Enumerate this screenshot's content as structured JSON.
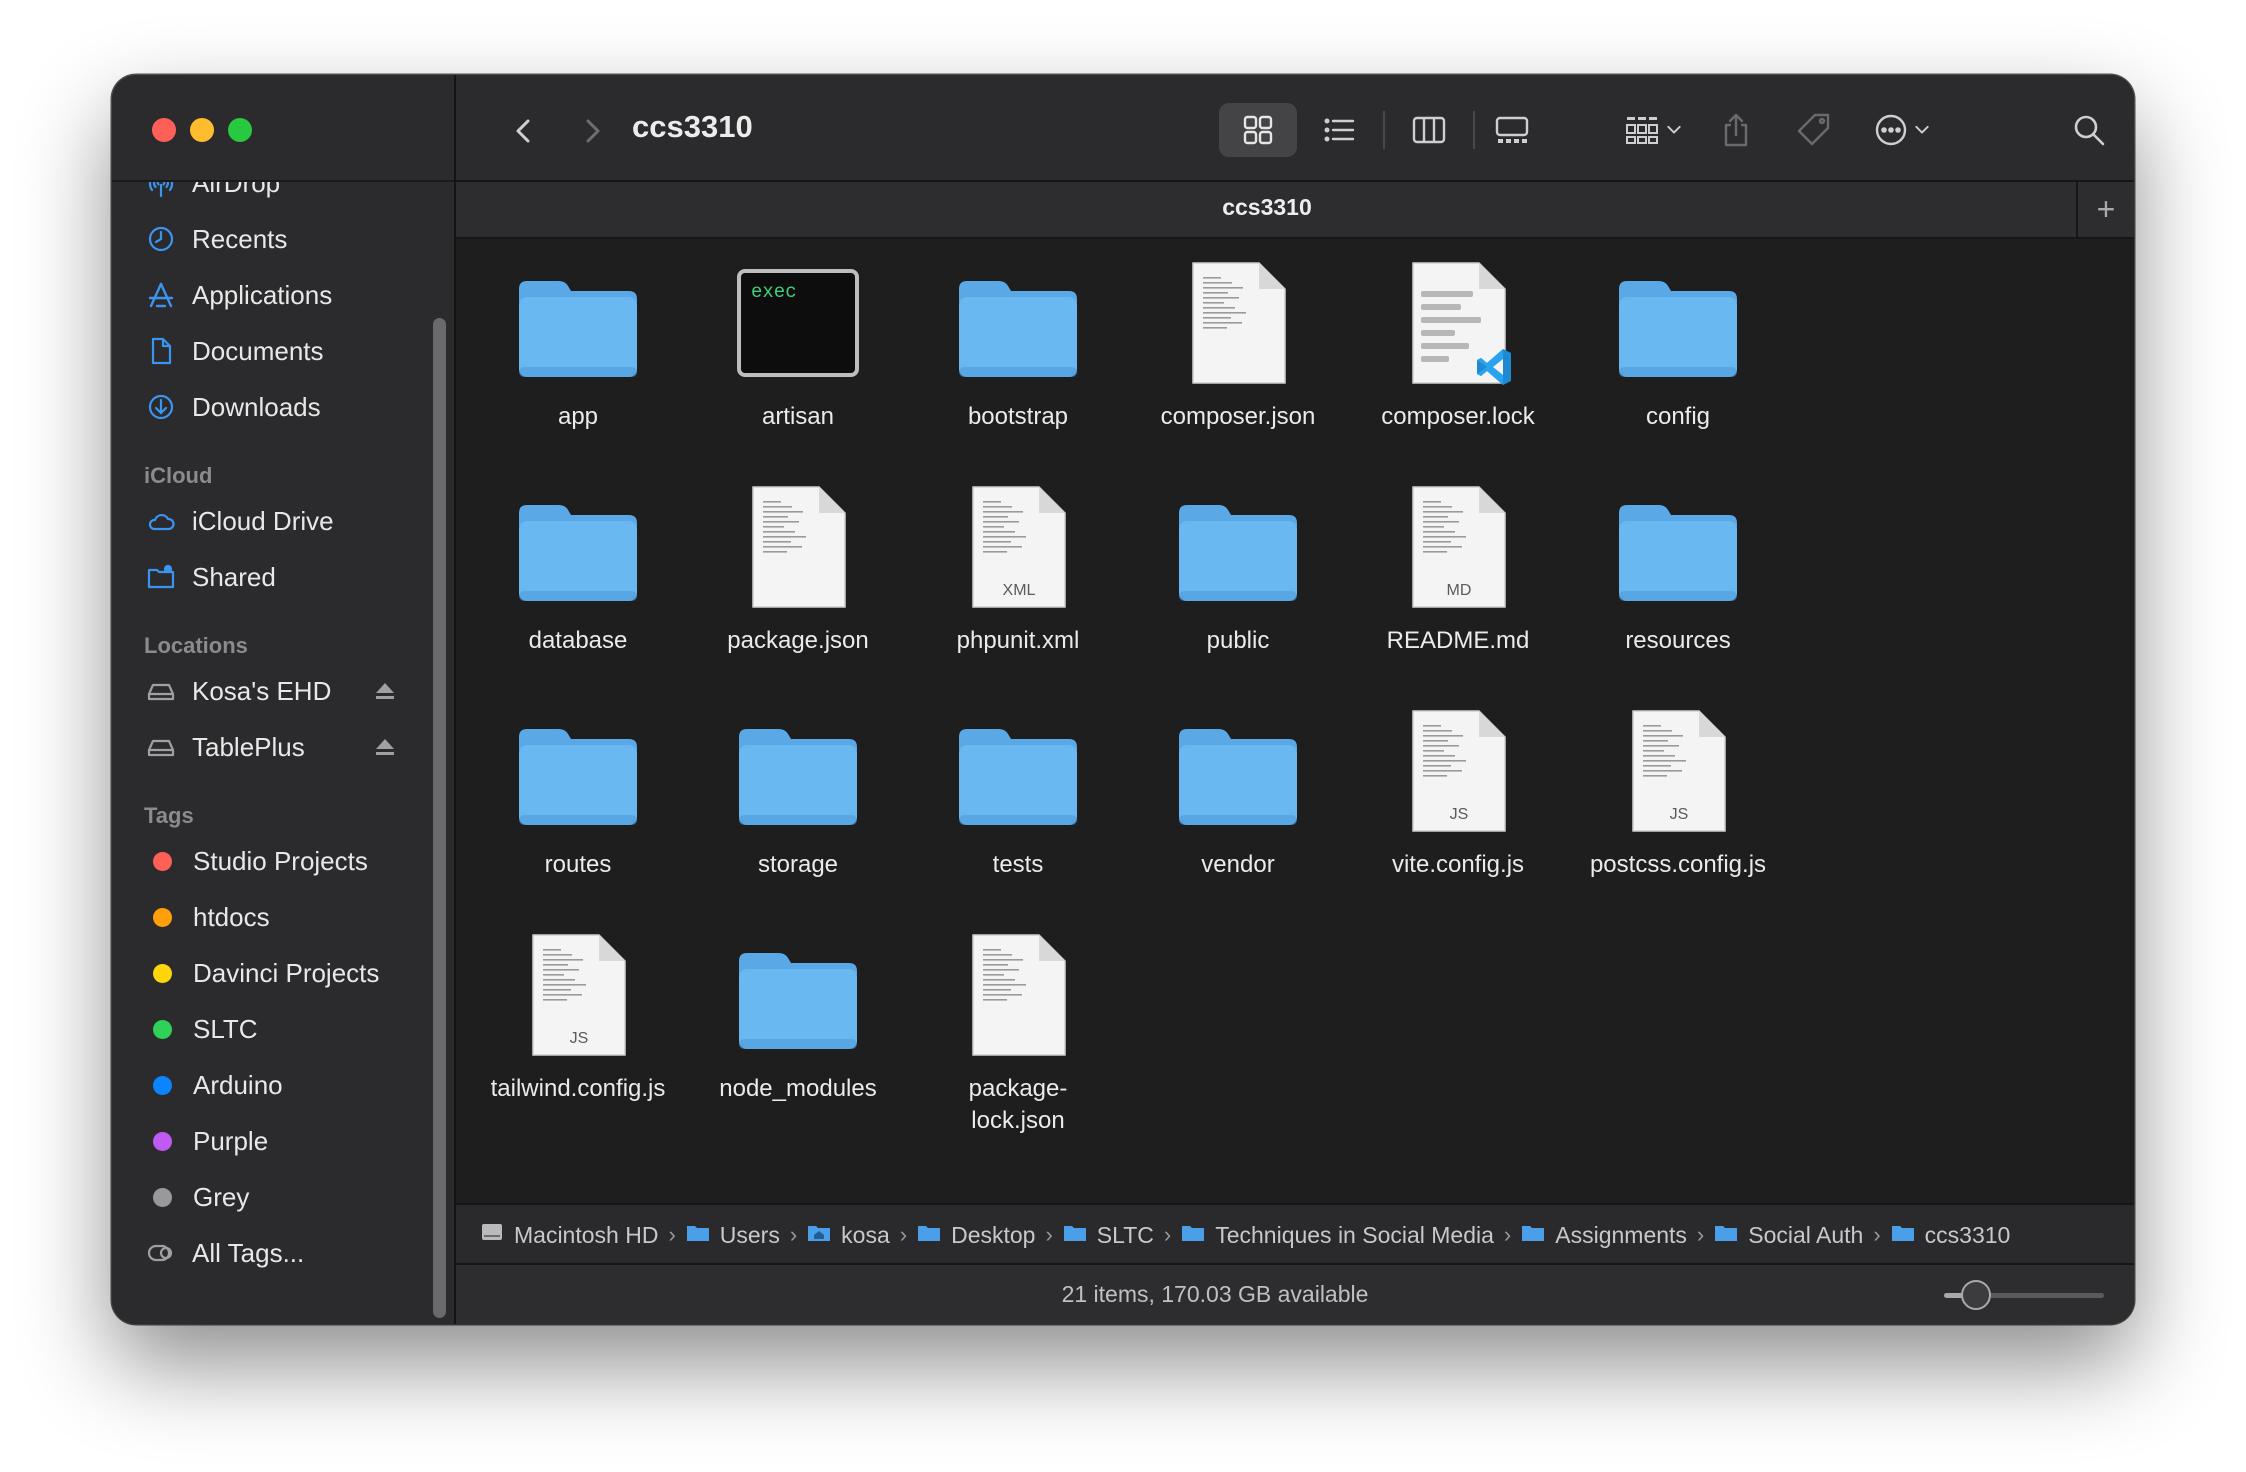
{
  "window": {
    "title": "ccs3310",
    "tab_label": "ccs3310",
    "tab_add": "+"
  },
  "sidebar": {
    "favorites": [
      {
        "label": "AirDrop",
        "icon": "airdrop-icon"
      },
      {
        "label": "Recents",
        "icon": "clock-icon"
      },
      {
        "label": "Applications",
        "icon": "applications-icon"
      },
      {
        "label": "Documents",
        "icon": "document-icon"
      },
      {
        "label": "Downloads",
        "icon": "download-icon"
      }
    ],
    "icloud_header": "iCloud",
    "icloud": [
      {
        "label": "iCloud Drive",
        "icon": "cloud-icon"
      },
      {
        "label": "Shared",
        "icon": "shared-folder-icon"
      }
    ],
    "locations_header": "Locations",
    "locations": [
      {
        "label": "Kosa's EHD",
        "icon": "drive-icon"
      },
      {
        "label": "TablePlus",
        "icon": "drive-icon"
      }
    ],
    "tags_header": "Tags",
    "tags": [
      {
        "label": "Studio Projects",
        "color": "#fe5f57"
      },
      {
        "label": "htdocs",
        "color": "#ff9f0a"
      },
      {
        "label": "Davinci Projects",
        "color": "#ffd60a"
      },
      {
        "label": "SLTC",
        "color": "#30d158"
      },
      {
        "label": "Arduino",
        "color": "#0a84ff"
      },
      {
        "label": "Purple",
        "color": "#bf5af2"
      },
      {
        "label": "Grey",
        "color": "#98989d"
      }
    ],
    "all_tags": "All Tags..."
  },
  "toolbar": {
    "view_icons": "icon-view",
    "view_list": "list-view",
    "view_columns": "column-view",
    "view_gallery": "gallery-view",
    "active_view": "icon-view"
  },
  "files": [
    {
      "name": "app",
      "kind": "folder"
    },
    {
      "name": "artisan",
      "kind": "exec",
      "badge": "exec"
    },
    {
      "name": "bootstrap",
      "kind": "folder"
    },
    {
      "name": "composer.json",
      "kind": "doc"
    },
    {
      "name": "composer.lock",
      "kind": "vscode"
    },
    {
      "name": "config",
      "kind": "folder"
    },
    {
      "name": "database",
      "kind": "folder"
    },
    {
      "name": "package.json",
      "kind": "doc"
    },
    {
      "name": "phpunit.xml",
      "kind": "doc",
      "badge": "XML"
    },
    {
      "name": "public",
      "kind": "folder"
    },
    {
      "name": "README.md",
      "kind": "doc",
      "badge": "MD"
    },
    {
      "name": "resources",
      "kind": "folder"
    },
    {
      "name": "routes",
      "kind": "folder"
    },
    {
      "name": "storage",
      "kind": "folder"
    },
    {
      "name": "tests",
      "kind": "folder"
    },
    {
      "name": "vendor",
      "kind": "folder"
    },
    {
      "name": "vite.config.js",
      "kind": "doc",
      "badge": "JS"
    },
    {
      "name": "postcss.config.js",
      "kind": "doc",
      "badge": "JS"
    },
    {
      "name": "tailwind.config.js",
      "kind": "doc",
      "badge": "JS"
    },
    {
      "name": "node_modules",
      "kind": "folder"
    },
    {
      "name": "package-\nlock.json",
      "kind": "doc"
    }
  ],
  "pathbar": [
    {
      "label": "Macintosh HD",
      "icon": "hard-disk-icon"
    },
    {
      "label": "Users",
      "icon": "folder-icon"
    },
    {
      "label": "kosa",
      "icon": "home-folder-icon"
    },
    {
      "label": "Desktop",
      "icon": "folder-icon"
    },
    {
      "label": "SLTC",
      "icon": "folder-icon"
    },
    {
      "label": "Techniques in Social Media",
      "icon": "folder-icon"
    },
    {
      "label": "Assignments",
      "icon": "folder-icon"
    },
    {
      "label": "Social Auth",
      "icon": "folder-icon"
    },
    {
      "label": "ccs3310",
      "icon": "folder-icon"
    }
  ],
  "status": {
    "text": "21 items, 170.03 GB available",
    "icon_size_level": 0.2
  },
  "colors": {
    "folder": "#6ab8f2",
    "accent": "#0a84ff",
    "sidebar_icon": "#3b94f0"
  }
}
